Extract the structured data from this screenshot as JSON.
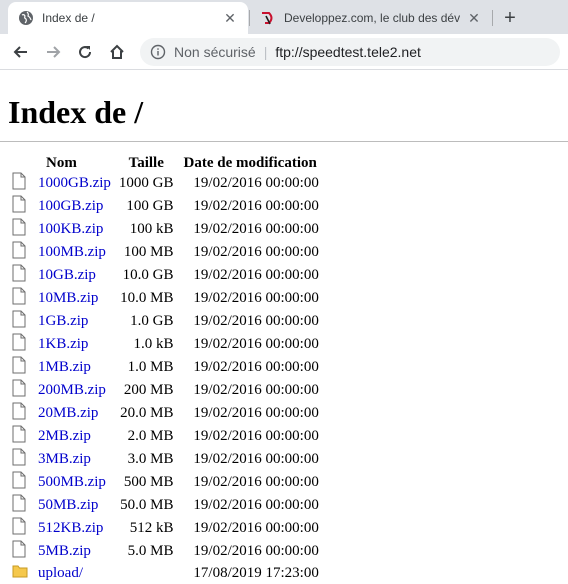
{
  "browser": {
    "tabs": [
      {
        "title": "Index de /",
        "active": true,
        "favicon": "globe-icon"
      },
      {
        "title": "Developpez.com, le club des développeurs",
        "active": false,
        "favicon": "developpez-icon"
      }
    ],
    "new_tab_label": "+",
    "omnibox": {
      "security_label": "Non sécurisé",
      "separator": "|",
      "url": "ftp://speedtest.tele2.net"
    }
  },
  "page": {
    "heading": "Index de /",
    "columns": {
      "name": "Nom",
      "size": "Taille",
      "date": "Date de modification"
    },
    "entries": [
      {
        "type": "file",
        "name": "1000GB.zip",
        "size": "1000 GB",
        "date": "19/02/2016 00:00:00"
      },
      {
        "type": "file",
        "name": "100GB.zip",
        "size": "100 GB",
        "date": "19/02/2016 00:00:00"
      },
      {
        "type": "file",
        "name": "100KB.zip",
        "size": "100 kB",
        "date": "19/02/2016 00:00:00"
      },
      {
        "type": "file",
        "name": "100MB.zip",
        "size": "100 MB",
        "date": "19/02/2016 00:00:00"
      },
      {
        "type": "file",
        "name": "10GB.zip",
        "size": "10.0 GB",
        "date": "19/02/2016 00:00:00"
      },
      {
        "type": "file",
        "name": "10MB.zip",
        "size": "10.0 MB",
        "date": "19/02/2016 00:00:00"
      },
      {
        "type": "file",
        "name": "1GB.zip",
        "size": "1.0 GB",
        "date": "19/02/2016 00:00:00"
      },
      {
        "type": "file",
        "name": "1KB.zip",
        "size": "1.0 kB",
        "date": "19/02/2016 00:00:00"
      },
      {
        "type": "file",
        "name": "1MB.zip",
        "size": "1.0 MB",
        "date": "19/02/2016 00:00:00"
      },
      {
        "type": "file",
        "name": "200MB.zip",
        "size": "200 MB",
        "date": "19/02/2016 00:00:00"
      },
      {
        "type": "file",
        "name": "20MB.zip",
        "size": "20.0 MB",
        "date": "19/02/2016 00:00:00"
      },
      {
        "type": "file",
        "name": "2MB.zip",
        "size": "2.0 MB",
        "date": "19/02/2016 00:00:00"
      },
      {
        "type": "file",
        "name": "3MB.zip",
        "size": "3.0 MB",
        "date": "19/02/2016 00:00:00"
      },
      {
        "type": "file",
        "name": "500MB.zip",
        "size": "500 MB",
        "date": "19/02/2016 00:00:00"
      },
      {
        "type": "file",
        "name": "50MB.zip",
        "size": "50.0 MB",
        "date": "19/02/2016 00:00:00"
      },
      {
        "type": "file",
        "name": "512KB.zip",
        "size": "512 kB",
        "date": "19/02/2016 00:00:00"
      },
      {
        "type": "file",
        "name": "5MB.zip",
        "size": "5.0 MB",
        "date": "19/02/2016 00:00:00"
      },
      {
        "type": "folder",
        "name": "upload/",
        "size": "",
        "date": "17/08/2019 17:23:00"
      }
    ]
  },
  "colors": {
    "link": "#0000cc",
    "tabstrip_bg": "#dee1e6",
    "omnibox_bg": "#f1f3f4",
    "folder": "#f5c84c"
  }
}
